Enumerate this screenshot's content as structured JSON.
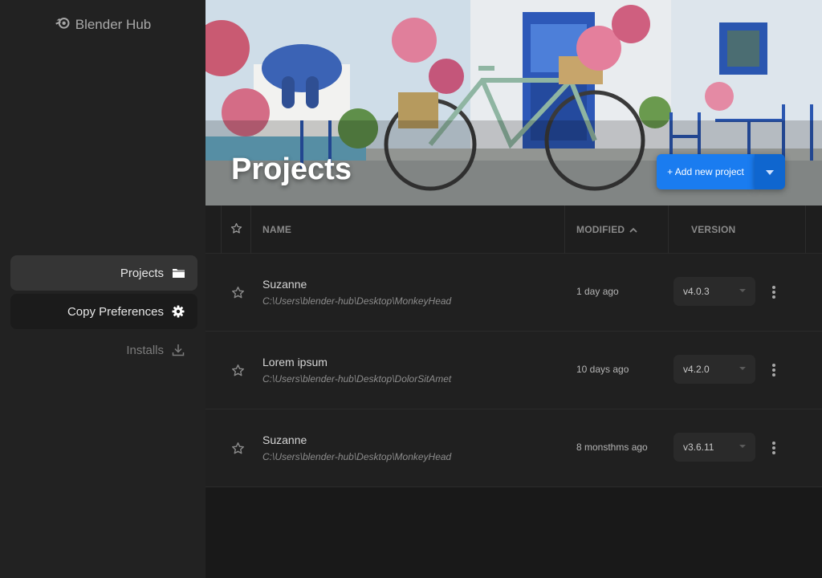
{
  "app": {
    "title": "Blender Hub"
  },
  "sidebar": {
    "items": [
      {
        "label": "Projects",
        "icon": "folder-icon",
        "active": true
      },
      {
        "label": "Copy Preferences",
        "icon": "gear-icon"
      },
      {
        "label": "Installs",
        "icon": "download-icon"
      }
    ]
  },
  "header": {
    "title": "Projects",
    "add_button": "+ Add new project",
    "dropdown_icon": "caret-down-icon"
  },
  "table": {
    "columns": {
      "name": "NAME",
      "modified": "MODIFIED",
      "version": "VERSION"
    },
    "sort": {
      "column": "modified",
      "direction": "ascending"
    },
    "rows": [
      {
        "name": "Suzanne",
        "path": "C:\\Users\\blender-hub\\Desktop\\MonkeyHead",
        "modified": "1 day ago",
        "version": "v4.0.3"
      },
      {
        "name": "Lorem ipsum",
        "path": "C:\\Users\\blender-hub\\Desktop\\DolorSitAmet",
        "modified": "10 days ago",
        "version": "v4.2.0"
      },
      {
        "name": "Suzanne",
        "path": "C:\\Users\\blender-hub\\Desktop\\MonkeyHead",
        "modified": "8 monsthms ago",
        "version": "v3.6.11"
      }
    ]
  },
  "colors": {
    "accent": "#1a7cf0",
    "accent_dark": "#0f66cf",
    "sidebar_bg": "#222222",
    "content_bg": "#191919"
  }
}
